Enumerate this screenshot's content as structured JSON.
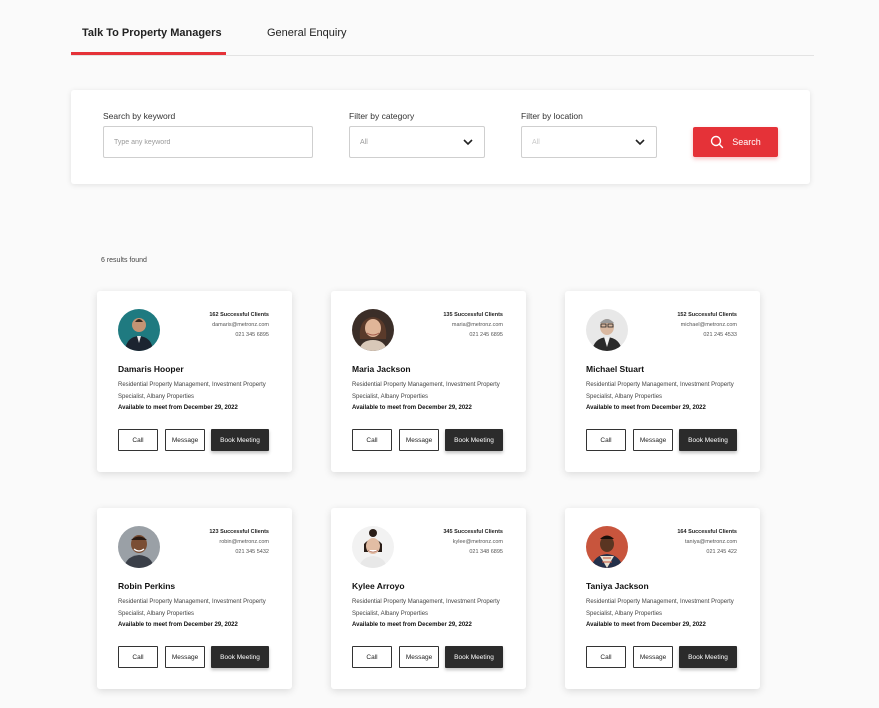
{
  "tabs": [
    {
      "label": "Talk To Property Managers",
      "active": true
    },
    {
      "label": "General Enquiry",
      "active": false
    }
  ],
  "filters": {
    "keyword_label": "Search by keyword",
    "keyword_placeholder": "Type any keyword",
    "category_label": "Filter by category",
    "category_value": "All",
    "location_label": "Filter by location",
    "location_value": "All",
    "search_button": "Search"
  },
  "results_text": "6 results found",
  "colors": {
    "accent": "#e53238",
    "dark_button": "#2b2b2b"
  },
  "managers": [
    {
      "name": "Damaris Hooper",
      "clients": "162 Successful Clients",
      "email": "damaris@metronz.com",
      "phone": "021 345 6895",
      "role": "Residential Property Management, Investment Property Specialist, Albany Properties",
      "availability": "Available to meet from December 29, 2022",
      "call": "Call",
      "message": "Message",
      "book": "Book Meeting"
    },
    {
      "name": "Maria Jackson",
      "clients": "135 Successful Clients",
      "email": "maria@metronz.com",
      "phone": "021 245 6895",
      "role": "Residential Property Management, Investment Property Specialist, Albany Properties",
      "availability": "Available to meet from December 29, 2022",
      "call": "Call",
      "message": "Message",
      "book": "Book Meeting"
    },
    {
      "name": "Michael Stuart",
      "clients": "152 Successful Clients",
      "email": "michael@metronz.com",
      "phone": "021 245 4533",
      "role": "Residential Property Management, Investment Property Specialist, Albany Properties",
      "availability": "Available to meet from December 29, 2022",
      "call": "Call",
      "message": "Message",
      "book": "Book Meeting"
    },
    {
      "name": "Robin Perkins",
      "clients": "123 Successful Clients",
      "email": "robin@metronz.com",
      "phone": "021 345 5432",
      "role": "Residential Property Management, Investment Property Specialist, Albany Properties",
      "availability": "Available to meet from December 29, 2022",
      "call": "Call",
      "message": "Message",
      "book": "Book Meeting"
    },
    {
      "name": "Kylee Arroyo",
      "clients": "345 Successful Clients",
      "email": "kylee@metronz.com",
      "phone": "021 348 6895",
      "role": "Residential Property Management, Investment Property Specialist, Albany Properties",
      "availability": "Available to meet from December 29, 2022",
      "call": "Call",
      "message": "Message",
      "book": "Book Meeting"
    },
    {
      "name": "Taniya Jackson",
      "clients": "164 Successful Clients",
      "email": "taniya@metronz.com",
      "phone": "021 245 422",
      "role": "Residential Property Management, Investment Property Specialist, Albany Properties",
      "availability": "Available to meet from December 29, 2022",
      "call": "Call",
      "message": "Message",
      "book": "Book Meeting"
    }
  ]
}
